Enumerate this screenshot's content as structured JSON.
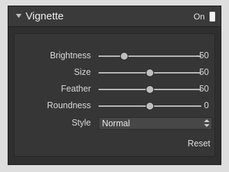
{
  "panel": {
    "title": "Vignette",
    "toggle_label": "On",
    "toggle_state": "on"
  },
  "sliders": [
    {
      "label": "Brightness",
      "value": "-50",
      "level": 0.25
    },
    {
      "label": "Size",
      "value": "50",
      "level": 0.5
    },
    {
      "label": "Feather",
      "value": "50",
      "level": 0.5
    },
    {
      "label": "Roundness",
      "value": "0",
      "level": 0.5
    }
  ],
  "style": {
    "label": "Style",
    "selected": "Normal"
  },
  "reset_label": "Reset",
  "colors": {
    "panel_bg": "#2f2f2f",
    "header_bg": "#3a3a3a",
    "text": "#e6e6e6"
  }
}
